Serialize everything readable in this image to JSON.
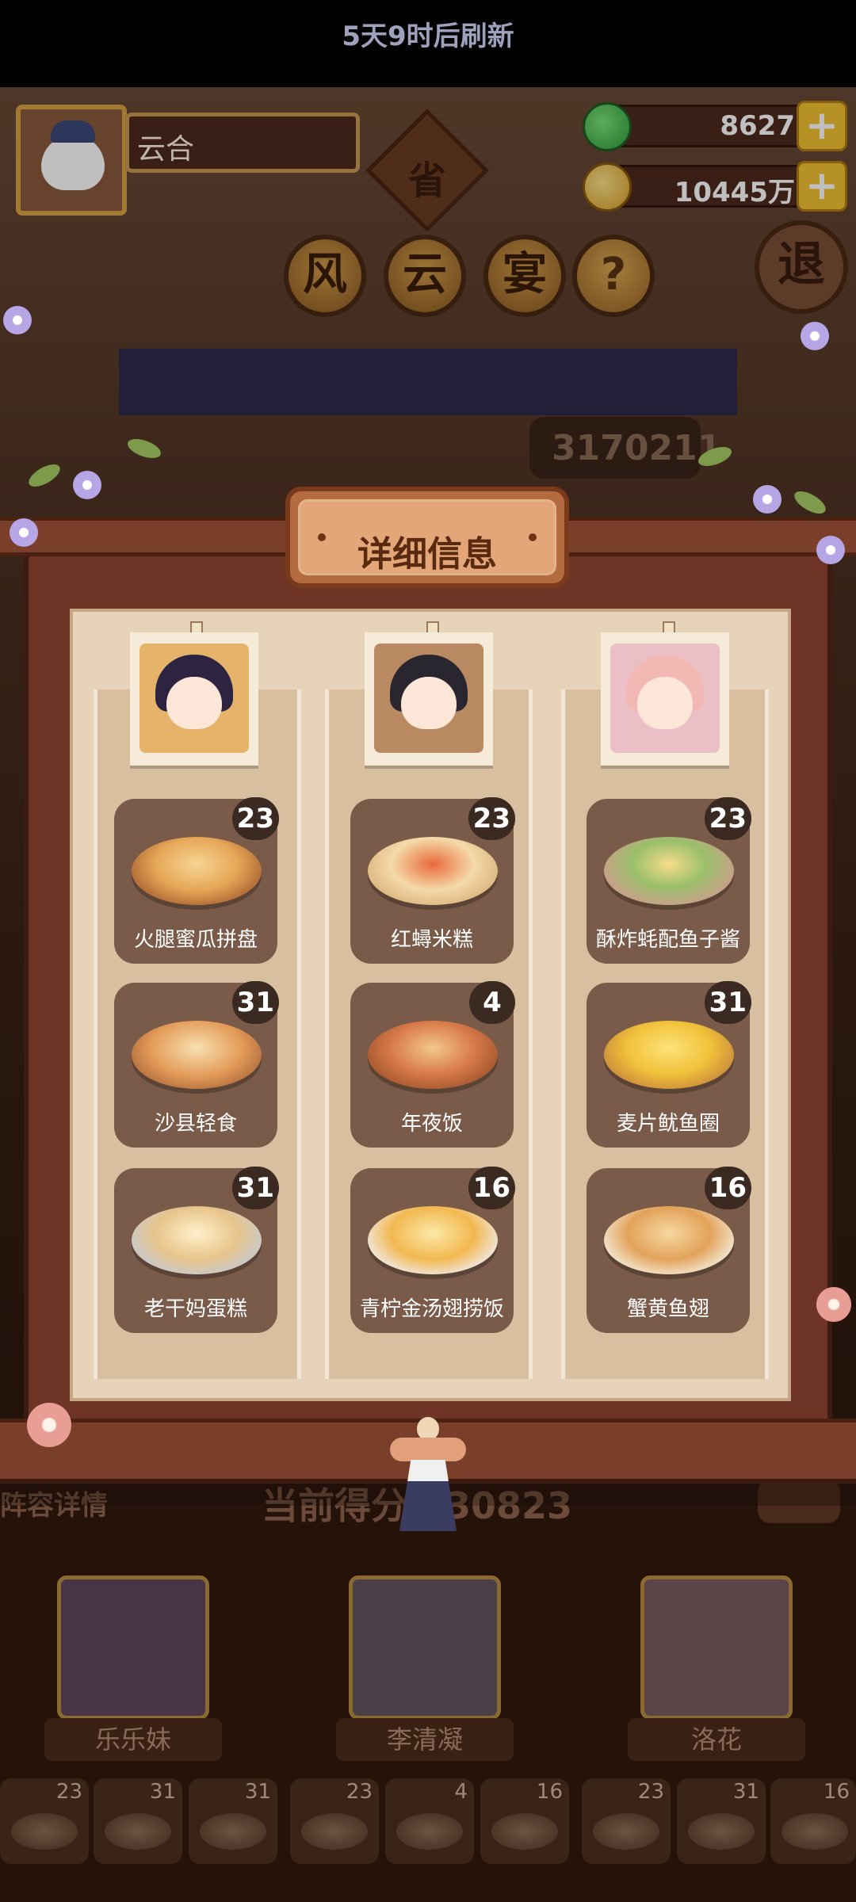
{
  "player": {
    "name": "云合"
  },
  "resources": {
    "jade": "8627",
    "coins": "10445万"
  },
  "event": {
    "badge": "省",
    "title_chars": [
      "风",
      "云",
      "宴"
    ],
    "help": "?",
    "exit": "退",
    "refresh_text": "5天9时后刷新",
    "top_score": "3170211"
  },
  "modal": {
    "title": "详细信息",
    "columns": [
      {
        "character": "乐乐妹",
        "dishes": [
          {
            "name": "火腿蜜瓜拼盘",
            "count": "23"
          },
          {
            "name": "沙县轻食",
            "count": "31"
          },
          {
            "name": "老干妈蛋糕",
            "count": "31"
          }
        ]
      },
      {
        "character": "李清凝",
        "dishes": [
          {
            "name": "红蟳米糕",
            "count": "23"
          },
          {
            "name": "年夜饭",
            "count": "4"
          },
          {
            "name": "青柠金汤翅捞饭",
            "count": "16"
          }
        ]
      },
      {
        "character": "洛花",
        "dishes": [
          {
            "name": "酥炸蚝配鱼子酱",
            "count": "23"
          },
          {
            "name": "麦片鱿鱼圈",
            "count": "31"
          },
          {
            "name": "蟹黄鱼翅",
            "count": "16"
          }
        ]
      }
    ]
  },
  "background": {
    "lineup_label": "阵容详情",
    "current_score": "当前得分 830823",
    "heroes": [
      "乐乐妹",
      "李清凝",
      "洛花"
    ],
    "mini_counts": [
      "23",
      "31",
      "31",
      "23",
      "4",
      "16",
      "23",
      "31",
      "16"
    ]
  },
  "colors": {
    "frame_wood": "#6e3526",
    "paper": "#e7d3b9",
    "card": "#7a5a48",
    "badge": "#3a2a22",
    "plus_button": "#f2c233"
  },
  "icons": [
    "jade-icon",
    "coin-icon",
    "plus-icon",
    "help-icon",
    "exit-icon"
  ]
}
